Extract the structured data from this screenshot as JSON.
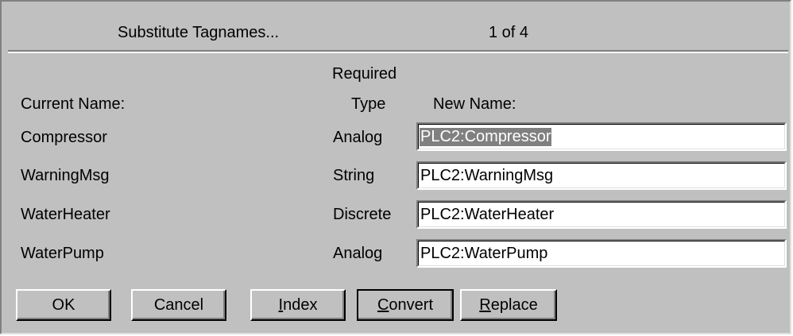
{
  "dialog": {
    "title": "Substitute Tagnames...",
    "page_indicator": "1 of  4"
  },
  "columns": {
    "current_name": "Current Name:",
    "required_line1": "Required",
    "required_line2": "Type",
    "new_name": "New Name:"
  },
  "rows": [
    {
      "current": "Compressor",
      "type": "Analog",
      "new": "PLC2:Compressor",
      "selected": true
    },
    {
      "current": "WarningMsg",
      "type": "String",
      "new": "PLC2:WarningMsg",
      "selected": false
    },
    {
      "current": "WaterHeater",
      "type": "Discrete",
      "new": "PLC2:WaterHeater",
      "selected": false
    },
    {
      "current": "WaterPump",
      "type": "Analog",
      "new": "PLC2:WaterPump",
      "selected": false
    }
  ],
  "buttons": {
    "ok": "OK",
    "cancel": "Cancel",
    "index": {
      "mnemonic": "I",
      "rest": "ndex"
    },
    "convert": {
      "mnemonic": "C",
      "rest": "onvert"
    },
    "replace": {
      "mnemonic": "R",
      "rest": "eplace"
    }
  },
  "colors": {
    "dialog_face": "#c0c0c0",
    "selection_highlight": "#808080",
    "field_background": "#ffffff"
  }
}
